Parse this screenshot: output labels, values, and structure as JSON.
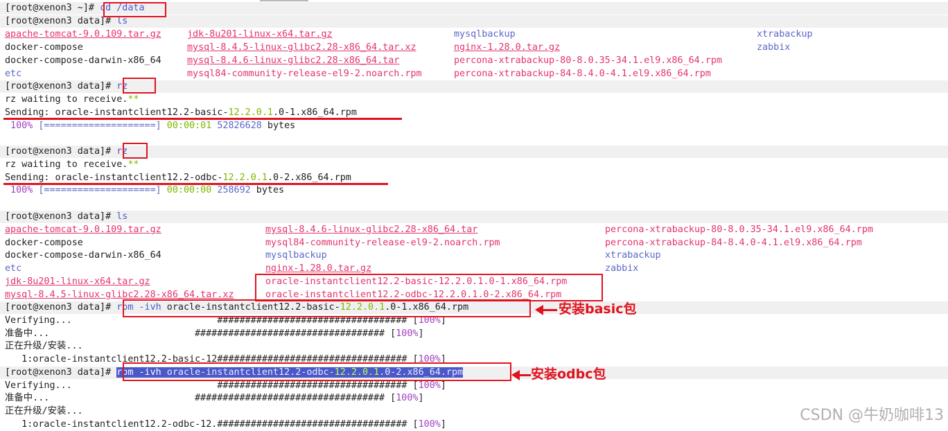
{
  "prompt": "[root@xenon3 ~]# ",
  "prompt_data": "[root@xenon3 data]# ",
  "cmd_cd": "cd /data",
  "cmd_ls": "ls",
  "cmd_rz": "rz",
  "ls1": {
    "col1": [
      "apache-tomcat-9.0.109.tar.gz",
      "docker-compose",
      "docker-compose-darwin-x86_64",
      "etc"
    ],
    "col2": [
      "jdk-8u201-linux-x64.tar.gz",
      "mysql-8.4.5-linux-glibc2.28-x86_64.tar.xz",
      "mysql-8.4.6-linux-glibc2.28-x86_64.tar",
      "mysql84-community-release-el9-2.noarch.rpm"
    ],
    "col3": [
      "mysqlbackup",
      "nginx-1.28.0.tar.gz",
      "percona-xtrabackup-80-8.0.35-34.1.el9.x86_64.rpm",
      "percona-xtrabackup-84-8.4.0-4.1.el9.x86_64.rpm"
    ],
    "col4": [
      "xtrabackup",
      "zabbix"
    ]
  },
  "rz_wait": "rz waiting to receive.",
  "rz_stars": "**",
  "send1": {
    "pre": "Sending: oracle-instantclient12.2-basic-",
    "num": "12.2.0.1",
    "post": ".0-1.x86_64.rpm"
  },
  "prog1": {
    "pct": " 100%",
    "bar": " [====================]",
    "time": " 00:00:01",
    "bytes": " 52826628",
    "unit": " bytes"
  },
  "send2": {
    "pre": "Sending: oracle-instantclient12.2-odbc-",
    "num": "12.2.0.1",
    "post": ".0-2.x86_64.rpm"
  },
  "prog2": {
    "pct": " 100%",
    "bar": " [====================]",
    "time": " 00:00:00",
    "bytes": " 258692",
    "unit": " bytes"
  },
  "ls2": {
    "col1": [
      "apache-tomcat-9.0.109.tar.gz",
      "docker-compose",
      "docker-compose-darwin-x86_64",
      "etc",
      "jdk-8u201-linux-x64.tar.gz",
      "mysql-8.4.5-linux-glibc2.28-x86_64.tar.xz"
    ],
    "col2": [
      "mysql-8.4.6-linux-glibc2.28-x86_64.tar",
      "mysql84-community-release-el9-2.noarch.rpm",
      "mysqlbackup",
      "nginx-1.28.0.tar.gz",
      "oracle-instantclient12.2-basic-12.2.0.1.0-1.x86_64.rpm",
      "oracle-instantclient12.2-odbc-12.2.0.1.0-2.x86_64.rpm"
    ],
    "col3": [
      "percona-xtrabackup-80-8.0.35-34.1.el9.x86_64.rpm",
      "percona-xtrabackup-84-8.4.0-4.1.el9.x86_64.rpm",
      "xtrabackup",
      "zabbix"
    ]
  },
  "rpm1": {
    "cmd": "rpm -ivh",
    "pre": " oracle-instantclient12.2-basic-",
    "num": "12.2.0.1",
    "post": ".0-1.x86_64.rpm"
  },
  "rpm2": {
    "cmd": "rpm -ivh",
    "pre": " oracle-instantclient12.2-odbc-",
    "num": "12.2.0.1",
    "post": ".0-2.x86_64.rpm"
  },
  "verifying": "Verifying...                          ",
  "preparing": "准备中...                          ",
  "upgrading": "正在升级/安装...",
  "hashes": "##################################",
  "hash_end": " [",
  "pct100": "100%",
  "close_br": "]",
  "inst1": "   1:oracle-instantclient12.2-basic-12",
  "inst2": "   1:oracle-instantclient12.2-odbc-12.",
  "note1": "安装basic包",
  "note2": "安装odbc包",
  "watermark": "CSDN @牛奶咖啡13",
  "colors": {
    "red": "#e0121e",
    "pink": "#e3336b",
    "blue": "#5a68c8",
    "green": "#7bb800"
  }
}
